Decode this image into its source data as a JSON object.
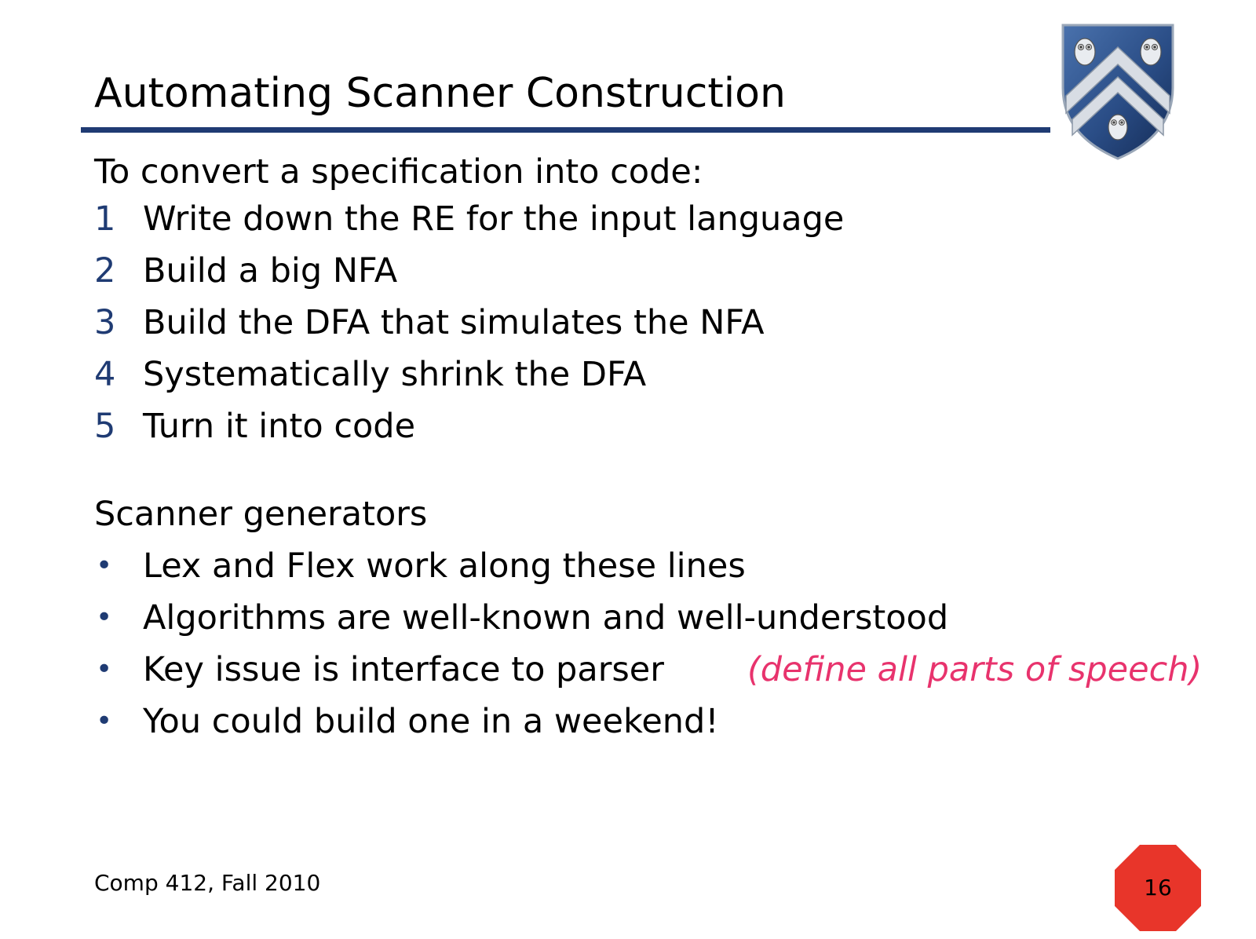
{
  "slide": {
    "title": "Automating Scanner Construction",
    "intro": "To convert a specification into code:",
    "steps": [
      {
        "number": "1",
        "text": "Write down the RE for the input language"
      },
      {
        "number": "2",
        "text": "Build a big NFA"
      },
      {
        "number": "3",
        "text": "Build the DFA that simulates the NFA"
      },
      {
        "number": "4",
        "text": "Systematically shrink the DFA"
      },
      {
        "number": "5",
        "text": "Turn it into code"
      }
    ],
    "section_heading": "Scanner generators",
    "bullets": [
      {
        "text": "Lex and Flex work along these lines"
      },
      {
        "text": "Algorithms are well-known and well-understood"
      },
      {
        "text": "Key issue is interface to parser",
        "aside": "(define all parts of speech)"
      },
      {
        "text": "You could build one in a weekend!"
      }
    ],
    "footer": "Comp 412, Fall 2010",
    "page_number": "16",
    "bullet_symbol": "•"
  },
  "colors": {
    "accent": "#1f3b73",
    "aside": "#e8336d",
    "badge": "#e8352a",
    "crest_blue": "#2a4d86",
    "crest_silver": "#d8dde4"
  },
  "icons": {
    "crest": "rice-university-owl-shield-icon",
    "page_badge": "octagon-stop-sign-icon"
  }
}
